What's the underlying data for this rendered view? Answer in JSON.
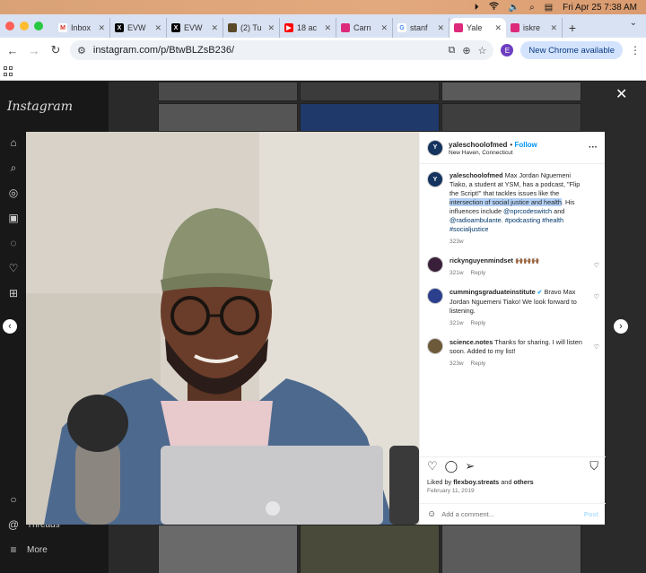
{
  "menubar": {
    "datetime": "Fri Apr 25  7:38 AM"
  },
  "tabs": [
    {
      "title": "Inbox",
      "fav_color": "#ffffff",
      "fav_text": "M",
      "fav_text_color": "#d93025"
    },
    {
      "title": "EVW",
      "fav_color": "#000000",
      "fav_text": "X",
      "fav_text_color": "#ffffff"
    },
    {
      "title": "EVW",
      "fav_color": "#000000",
      "fav_text": "X",
      "fav_text_color": "#ffffff"
    },
    {
      "title": "(2) Tu",
      "fav_color": "#5a4a2a",
      "fav_text": "",
      "fav_text_color": "#ffffff"
    },
    {
      "title": "18 ac",
      "fav_color": "#ff0000",
      "fav_text": "▶",
      "fav_text_color": "#ffffff"
    },
    {
      "title": "Carn",
      "fav_color": "#dd2a7b",
      "fav_text": "",
      "fav_text_color": "#ffffff"
    },
    {
      "title": "stanf",
      "fav_color": "#ffffff",
      "fav_text": "G",
      "fav_text_color": "#4285f4"
    },
    {
      "title": "Yale",
      "fav_color": "#dd2a7b",
      "fav_text": "",
      "fav_text_color": "#ffffff",
      "active": true
    },
    {
      "title": "iskre",
      "fav_color": "#dd2a7b",
      "fav_text": "",
      "fav_text_color": "#ffffff"
    }
  ],
  "address": {
    "url": "instagram.com/p/BtwBLZsB236/",
    "profile_initial": "E",
    "new_chrome": "New Chrome available"
  },
  "sidebar": {
    "logo": "Instagram",
    "threads": "Threads",
    "more": "More"
  },
  "post": {
    "username": "yaleschoolofmed",
    "follow": "Follow",
    "location": "New Haven, Connecticut",
    "avatar_text": "Y",
    "caption_user": "yaleschoolofmed",
    "caption_a": "Max Jordan Nguemeni Tiako, a student at YSM, has a podcast, \"Flip the Script!\" that tackles issues like the ",
    "caption_hl": "intersection of social justice and health",
    "caption_b": ". His influences include ",
    "mention1": "@nprcodeswitch",
    "caption_and": " and ",
    "mention2": "@radioambulante",
    "caption_dot": ".",
    "hashtags": "#podcasting #health #socialjustice",
    "caption_time": "323w",
    "comments": [
      {
        "user": "rickynguyenmindset",
        "text": "🙌🏾🙌🏾🙌🏾",
        "time": "321w",
        "reply": "Reply",
        "avatar_color": "#3a1f3a",
        "verified": false
      },
      {
        "user": "cummingsgraduateinstitute",
        "text": "Bravo Max Jordan Nguemeni Tiako! We look forward to listening.",
        "time": "321w",
        "reply": "Reply",
        "avatar_color": "#2b3f8c",
        "verified": true
      },
      {
        "user": "science.notes",
        "text": "Thanks for sharing. I will listen soon. Added to my list!",
        "time": "323w",
        "reply": "Reply",
        "avatar_color": "#6d5a3a",
        "verified": false
      }
    ],
    "liked_prefix": "Liked by ",
    "liked_user": "flexboy.streats",
    "liked_and": " and ",
    "liked_others": "others",
    "date": "February 11, 2019",
    "add_comment": "Add a comment...",
    "post_btn": "Post"
  }
}
